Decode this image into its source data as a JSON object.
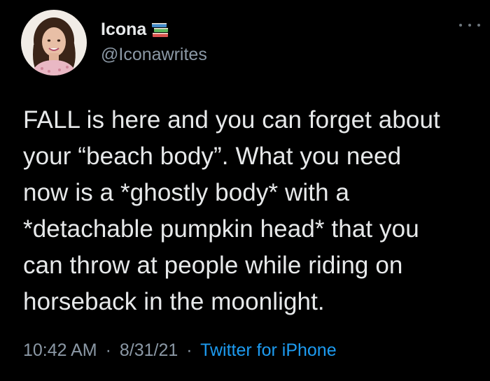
{
  "user": {
    "display_name": "Icona",
    "handle": "@Iconawrites",
    "name_emoji": "books-icon"
  },
  "tweet": {
    "text": "FALL is here and you can forget about\nyour “beach body”. What you need\nnow is a *ghostly body* with a\n*detachable pumpkin head* that you\ncan throw at people while riding on\nhorseback in the moonlight."
  },
  "meta": {
    "time": "10:42 AM",
    "date": "8/31/21",
    "separator": "·",
    "source": "Twitter for iPhone"
  },
  "colors": {
    "background": "#000000",
    "text": "#e7e9ea",
    "muted": "#8b98a5",
    "link": "#1d9bf0"
  }
}
